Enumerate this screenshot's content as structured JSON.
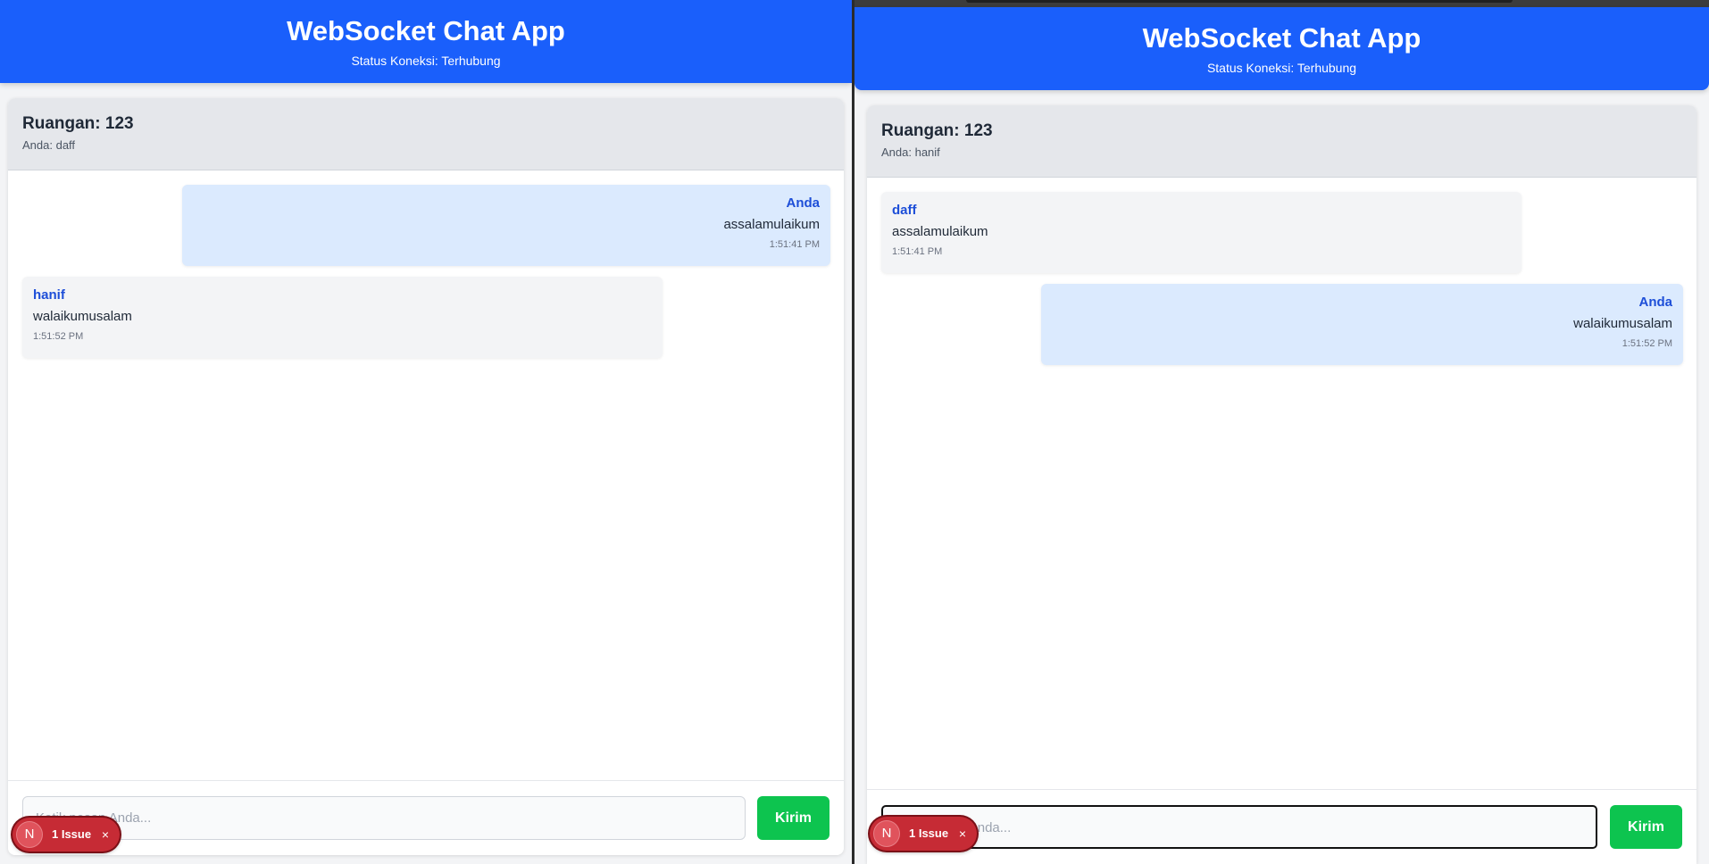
{
  "app": {
    "title": "WebSocket Chat App",
    "status": "Status Koneksi: Terhubung"
  },
  "left_window": {
    "room_title": "Ruangan: 123",
    "room_user": "Anda: daff",
    "messages": [
      {
        "sender": "Anda",
        "text": "assalamulaikum",
        "time": "1:51:41 PM",
        "own": true
      },
      {
        "sender": "hanif",
        "text": "walaikumusalam",
        "time": "1:51:52 PM",
        "own": false
      }
    ],
    "input_placeholder": "Ketik pesan Anda...",
    "send_label": "Kirim",
    "issue_badge": {
      "logo": "N",
      "label": "1 Issue",
      "close": "×"
    }
  },
  "right_window": {
    "room_title": "Ruangan: 123",
    "room_user": "Anda: hanif",
    "messages": [
      {
        "sender": "daff",
        "text": "assalamulaikum",
        "time": "1:51:41 PM",
        "own": false
      },
      {
        "sender": "Anda",
        "text": "walaikumusalam",
        "time": "1:51:52 PM",
        "own": true
      }
    ],
    "input_placeholder": "Ketik pesan Anda...",
    "send_label": "Kirim",
    "issue_badge": {
      "logo": "N",
      "label": "1 Issue",
      "close": "×"
    }
  },
  "colors": {
    "header_blue": "#1a5ffb",
    "own_bubble": "#dbeafe",
    "other_bubble": "#f3f4f6",
    "sender_blue": "#1d4ed8",
    "send_green": "#0dc44f",
    "issue_red": "#c62b35"
  }
}
